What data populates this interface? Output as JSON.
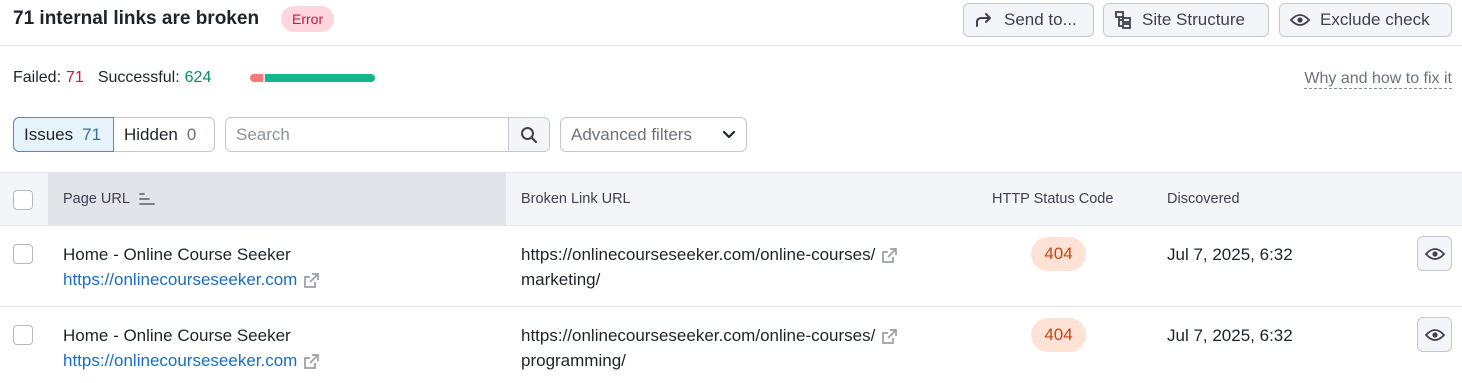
{
  "header": {
    "title": "71 internal links are broken",
    "badge": "Error",
    "buttons": {
      "send_label": "Send to...",
      "site_structure_label": "Site Structure",
      "exclude_label": "Exclude check"
    }
  },
  "summary": {
    "failed_label": "Failed:",
    "failed_value": "71",
    "successful_label": "Successful:",
    "successful_value": "624",
    "progress_fail_fraction": 0.102,
    "fix_link": "Why and how to fix it"
  },
  "filters": {
    "tabs": [
      {
        "label": "Issues",
        "count": "71",
        "active": true
      },
      {
        "label": "Hidden",
        "count": "0",
        "active": false
      }
    ],
    "search_placeholder": "Search",
    "advanced_filters_label": "Advanced filters"
  },
  "table": {
    "columns": {
      "page_url": "Page URL",
      "broken_link_url": "Broken Link URL",
      "http_status": "HTTP Status Code",
      "discovered": "Discovered"
    },
    "rows": [
      {
        "page_title": "Home - Online Course Seeker",
        "page_url": "https://onlinecourseseeker.com",
        "broken_url_line1": "https://onlinecourseseeker.com/online-courses/",
        "broken_url_line2": "marketing/",
        "status": "404",
        "discovered": "Jul 7, 2025, 6:32"
      },
      {
        "page_title": "Home - Online Course Seeker",
        "page_url": "https://onlinecourseseeker.com",
        "broken_url_line1": "https://onlinecourseseeker.com/online-courses/",
        "broken_url_line2": "programming/",
        "status": "404",
        "discovered": "Jul 7, 2025, 6:32"
      }
    ]
  },
  "colors": {
    "error": "#c2184b",
    "success": "#0a8a63",
    "link": "#1a6dbf",
    "status_bg": "#ffe2d6"
  }
}
